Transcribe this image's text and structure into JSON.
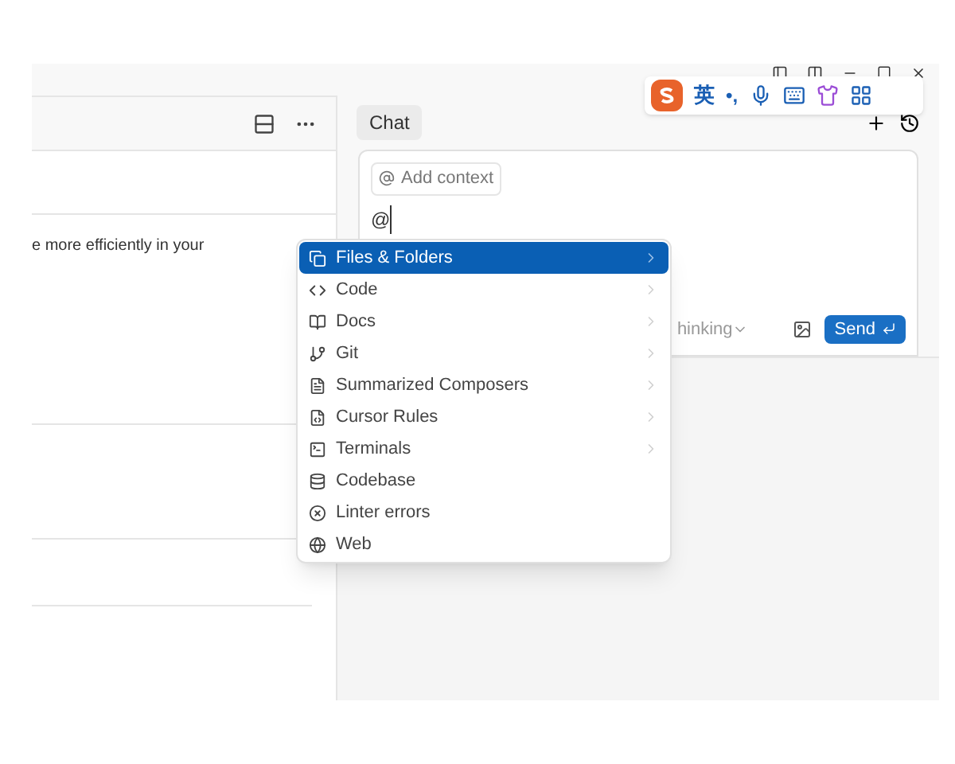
{
  "left_panel": {
    "text": "e more efficiently in your"
  },
  "chat": {
    "tab": "Chat",
    "context_chip": "Add context",
    "input_value": "@",
    "mode_label": "hinking",
    "send": "Send"
  },
  "ime_toolbar": {
    "language": "英",
    "punctuation": "•,"
  },
  "mention_menu": {
    "items": [
      {
        "kind": "files",
        "label": "Files & Folders",
        "selected": true,
        "submenu": true
      },
      {
        "kind": "code",
        "label": "Code",
        "selected": false,
        "submenu": true
      },
      {
        "kind": "docs",
        "label": "Docs",
        "selected": false,
        "submenu": true
      },
      {
        "kind": "git",
        "label": "Git",
        "selected": false,
        "submenu": true
      },
      {
        "kind": "composers",
        "label": "Summarized Composers",
        "selected": false,
        "submenu": true
      },
      {
        "kind": "rules",
        "label": "Cursor Rules",
        "selected": false,
        "submenu": true
      },
      {
        "kind": "terminals",
        "label": "Terminals",
        "selected": false,
        "submenu": true
      },
      {
        "kind": "codebase",
        "label": "Codebase",
        "selected": false,
        "submenu": false
      },
      {
        "kind": "linter",
        "label": "Linter errors",
        "selected": false,
        "submenu": false
      },
      {
        "kind": "web",
        "label": "Web",
        "selected": false,
        "submenu": false
      }
    ]
  }
}
